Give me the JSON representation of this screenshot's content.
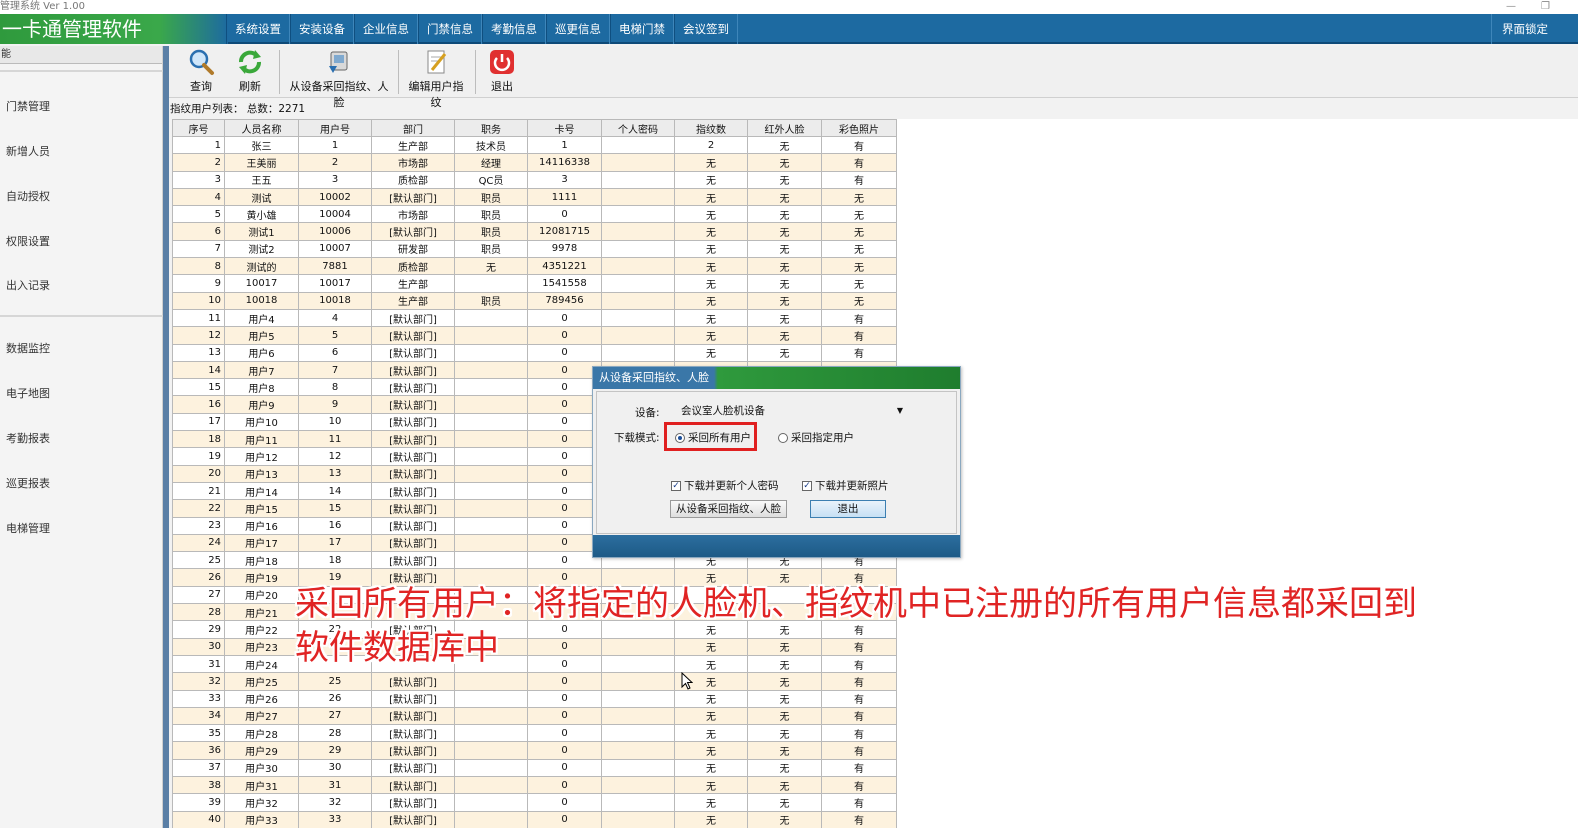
{
  "window": {
    "title": "管理系统  Ver 1.00"
  },
  "menubar": {
    "brand": "一卡通管理软件",
    "items": [
      "系统设置",
      "安装设备",
      "企业信息",
      "门禁信息",
      "考勤信息",
      "巡更信息",
      "电梯门禁",
      "会议签到"
    ],
    "lock": "界面锁定"
  },
  "sidebar": {
    "header": "能",
    "items": [
      "门禁管理",
      "新增人员",
      "自动授权",
      "权限设置",
      "出入记录",
      "数据监控",
      "电子地图",
      "考勤报表",
      "巡更报表",
      "电梯管理"
    ]
  },
  "toolbar": {
    "query": "查询",
    "refresh": "刷新",
    "fetch": "从设备采回指纹、人脸",
    "edit": "编辑用户指纹",
    "exit": "退出"
  },
  "list": {
    "caption": "指纹用户列表：  总数：2271"
  },
  "table": {
    "columns": [
      "序号",
      "人员名称",
      "用户号",
      "部门",
      "职务",
      "卡号",
      "个人密码",
      "指纹数",
      "红外人脸",
      "彩色照片"
    ],
    "rows": [
      [
        "1",
        "张三",
        "1",
        "生产部",
        "技术员",
        "1",
        "",
        "2",
        "无",
        "有"
      ],
      [
        "2",
        "王美丽",
        "2",
        "市场部",
        "经理",
        "14116338",
        "",
        "无",
        "无",
        "有"
      ],
      [
        "3",
        "王五",
        "3",
        "质检部",
        "QC员",
        "3",
        "",
        "无",
        "无",
        "有"
      ],
      [
        "4",
        "测试",
        "10002",
        "[默认部门]",
        "职员",
        "1111",
        "",
        "无",
        "无",
        "无"
      ],
      [
        "5",
        "黄小雄",
        "10004",
        "市场部",
        "职员",
        "0",
        "",
        "无",
        "无",
        "无"
      ],
      [
        "6",
        "测试1",
        "10006",
        "[默认部门]",
        "职员",
        "12081715",
        "",
        "无",
        "无",
        "无"
      ],
      [
        "7",
        "测试2",
        "10007",
        "研发部",
        "职员",
        "9978",
        "",
        "无",
        "无",
        "无"
      ],
      [
        "8",
        "测试的",
        "7881",
        "质检部",
        "无",
        "4351221",
        "",
        "无",
        "无",
        "无"
      ],
      [
        "9",
        "10017",
        "10017",
        "生产部",
        "",
        "1541558",
        "",
        "无",
        "无",
        "无"
      ],
      [
        "10",
        "10018",
        "10018",
        "生产部",
        "职员",
        "789456",
        "",
        "无",
        "无",
        "无"
      ],
      [
        "11",
        "用户4",
        "4",
        "[默认部门]",
        "",
        "0",
        "",
        "无",
        "无",
        "有"
      ],
      [
        "12",
        "用户5",
        "5",
        "[默认部门]",
        "",
        "0",
        "",
        "无",
        "无",
        "有"
      ],
      [
        "13",
        "用户6",
        "6",
        "[默认部门]",
        "",
        "0",
        "",
        "无",
        "无",
        "有"
      ],
      [
        "14",
        "用户7",
        "7",
        "[默认部门]",
        "",
        "0",
        "",
        "",
        "",
        ""
      ],
      [
        "15",
        "用户8",
        "8",
        "[默认部门]",
        "",
        "0",
        "",
        "",
        "",
        ""
      ],
      [
        "16",
        "用户9",
        "9",
        "[默认部门]",
        "",
        "0",
        "",
        "",
        "",
        ""
      ],
      [
        "17",
        "用户10",
        "10",
        "[默认部门]",
        "",
        "0",
        "",
        "",
        "",
        ""
      ],
      [
        "18",
        "用户11",
        "11",
        "[默认部门]",
        "",
        "0",
        "",
        "",
        "",
        ""
      ],
      [
        "19",
        "用户12",
        "12",
        "[默认部门]",
        "",
        "0",
        "",
        "",
        "",
        ""
      ],
      [
        "20",
        "用户13",
        "13",
        "[默认部门]",
        "",
        "0",
        "",
        "",
        "",
        ""
      ],
      [
        "21",
        "用户14",
        "14",
        "[默认部门]",
        "",
        "0",
        "",
        "",
        "",
        ""
      ],
      [
        "22",
        "用户15",
        "15",
        "[默认部门]",
        "",
        "0",
        "",
        "",
        "",
        ""
      ],
      [
        "23",
        "用户16",
        "16",
        "[默认部门]",
        "",
        "0",
        "",
        "",
        "",
        ""
      ],
      [
        "24",
        "用户17",
        "17",
        "[默认部门]",
        "",
        "0",
        "",
        "",
        "",
        ""
      ],
      [
        "25",
        "用户18",
        "18",
        "[默认部门]",
        "",
        "0",
        "",
        "无",
        "无",
        "有"
      ],
      [
        "26",
        "用户19",
        "19",
        "[默认部门]",
        "",
        "0",
        "",
        "无",
        "无",
        "有"
      ],
      [
        "27",
        "用户20",
        "",
        "",
        "",
        "",
        "",
        "",
        "",
        ""
      ],
      [
        "28",
        "用户21",
        "",
        "",
        "",
        "",
        "",
        "",
        "",
        ""
      ],
      [
        "29",
        "用户22",
        "22",
        "[默认部门]",
        "",
        "0",
        "",
        "无",
        "无",
        "有"
      ],
      [
        "30",
        "用户23",
        "",
        "",
        "",
        "0",
        "",
        "无",
        "无",
        "有"
      ],
      [
        "31",
        "用户24",
        "",
        "",
        "",
        "0",
        "",
        "无",
        "无",
        "有"
      ],
      [
        "32",
        "用户25",
        "25",
        "[默认部门]",
        "",
        "0",
        "",
        "无",
        "无",
        "有"
      ],
      [
        "33",
        "用户26",
        "26",
        "[默认部门]",
        "",
        "0",
        "",
        "无",
        "无",
        "有"
      ],
      [
        "34",
        "用户27",
        "27",
        "[默认部门]",
        "",
        "0",
        "",
        "无",
        "无",
        "有"
      ],
      [
        "35",
        "用户28",
        "28",
        "[默认部门]",
        "",
        "0",
        "",
        "无",
        "无",
        "有"
      ],
      [
        "36",
        "用户29",
        "29",
        "[默认部门]",
        "",
        "0",
        "",
        "无",
        "无",
        "有"
      ],
      [
        "37",
        "用户30",
        "30",
        "[默认部门]",
        "",
        "0",
        "",
        "无",
        "无",
        "有"
      ],
      [
        "38",
        "用户31",
        "31",
        "[默认部门]",
        "",
        "0",
        "",
        "无",
        "无",
        "有"
      ],
      [
        "39",
        "用户32",
        "32",
        "[默认部门]",
        "",
        "0",
        "",
        "无",
        "无",
        "有"
      ],
      [
        "40",
        "用户33",
        "33",
        "[默认部门]",
        "",
        "0",
        "",
        "无",
        "无",
        "有"
      ]
    ]
  },
  "dialog": {
    "title": "从设备采回指纹、人脸",
    "device_label": "设备:",
    "device_value": "会议室人脸机设备",
    "mode_label": "下载模式:",
    "radio_all": "采回所有用户",
    "radio_specific": "采回指定用户",
    "check_password": "下载并更新个人密码",
    "check_photo": "下载并更新照片",
    "fetch_button": "从设备采回指纹、人脸",
    "exit_button": "退出"
  },
  "caption": {
    "line1": "采回所有用户：将指定的人脸机、指纹机中已注册的所有用户信息都采回到",
    "line2": "软件数据库中"
  },
  "colors": {
    "menubar": "#1d6aa1",
    "brand": "#2f9a3d",
    "row_alt": "#fdf2de",
    "highlight": "#e02020",
    "caption": "#e02424"
  }
}
